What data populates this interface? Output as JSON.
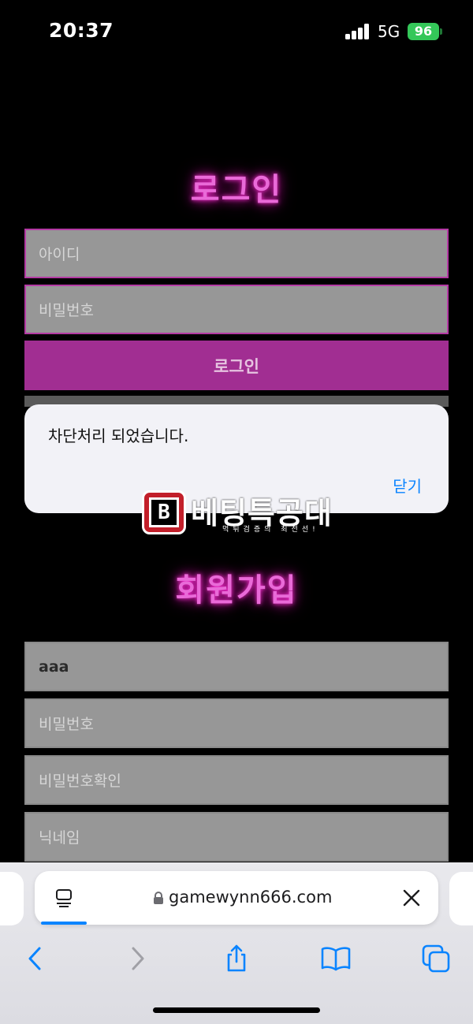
{
  "status_bar": {
    "time": "20:37",
    "network": "5G",
    "battery": "96"
  },
  "login": {
    "title": "로그인",
    "id_placeholder": "아이디",
    "password_placeholder": "비밀번호",
    "button_label": "로그인"
  },
  "dialog": {
    "message": "차단처리 되었습니다.",
    "close_label": "닫기"
  },
  "watermark": {
    "logo_glyph": "B",
    "name": "베팅특공대",
    "tagline": "먹튀검증의 최전선!"
  },
  "signup": {
    "title": "회원가입",
    "id_value": "aaa",
    "password_placeholder": "비밀번호",
    "password_confirm_placeholder": "비밀번호확인",
    "nickname_placeholder": "닉네임"
  },
  "browser": {
    "url": "gamewynn666.com"
  },
  "colors": {
    "accent_pink": "#a12e92",
    "glow": "#ff2fd6",
    "link_blue": "#0a84ff"
  },
  "icons": [
    "signal-icon",
    "battery-icon",
    "tab-overview-icon",
    "lock-icon",
    "close-icon",
    "back-icon",
    "forward-icon",
    "share-icon",
    "bookmarks-icon",
    "tabs-icon"
  ]
}
